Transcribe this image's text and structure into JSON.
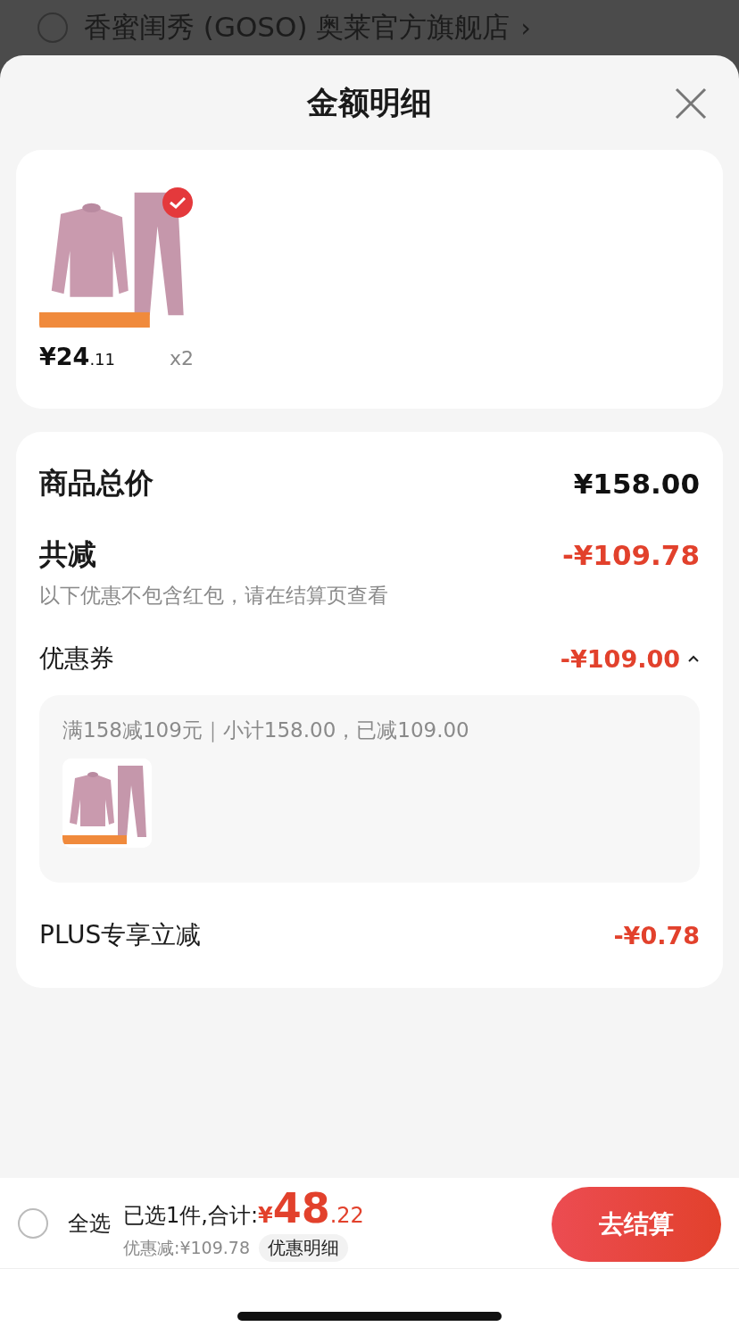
{
  "store": {
    "name": "香蜜闺秀 (GOSO) 奥莱官方旗舰店",
    "chevron": "›",
    "selected": false
  },
  "sheet": {
    "title": "金额明细"
  },
  "items": [
    {
      "kind": "picture",
      "selected": true,
      "price_integer": "¥24",
      "price_decimal": ".11",
      "quantity": "x2"
    }
  ],
  "summary": [
    {
      "kind": "total",
      "label": "商品总价",
      "amount": "¥158.00"
    },
    {
      "kind": "reduction",
      "label": "共减",
      "amount": "-¥109.78",
      "note": "以下优惠不包含红包，请在结算页查看"
    },
    {
      "kind": "coupon",
      "label": "优惠券",
      "amount": "-¥109.00",
      "expanded": true,
      "detail": {
        "text": "满158减109元｜小计158.00，已减109.00"
      }
    },
    {
      "kind": "plus",
      "label": "PLUS专享立减",
      "amount": "-¥0.78"
    }
  ],
  "footer": {
    "select_all": {
      "label": "全选",
      "checked": false
    },
    "selected_text": "已选1件,合计:",
    "total_currency": "¥",
    "total_integer": "48",
    "total_decimal": ".22",
    "savings": "优惠减:¥109.78",
    "details_link": "优惠明细",
    "checkout": "去结算"
  }
}
